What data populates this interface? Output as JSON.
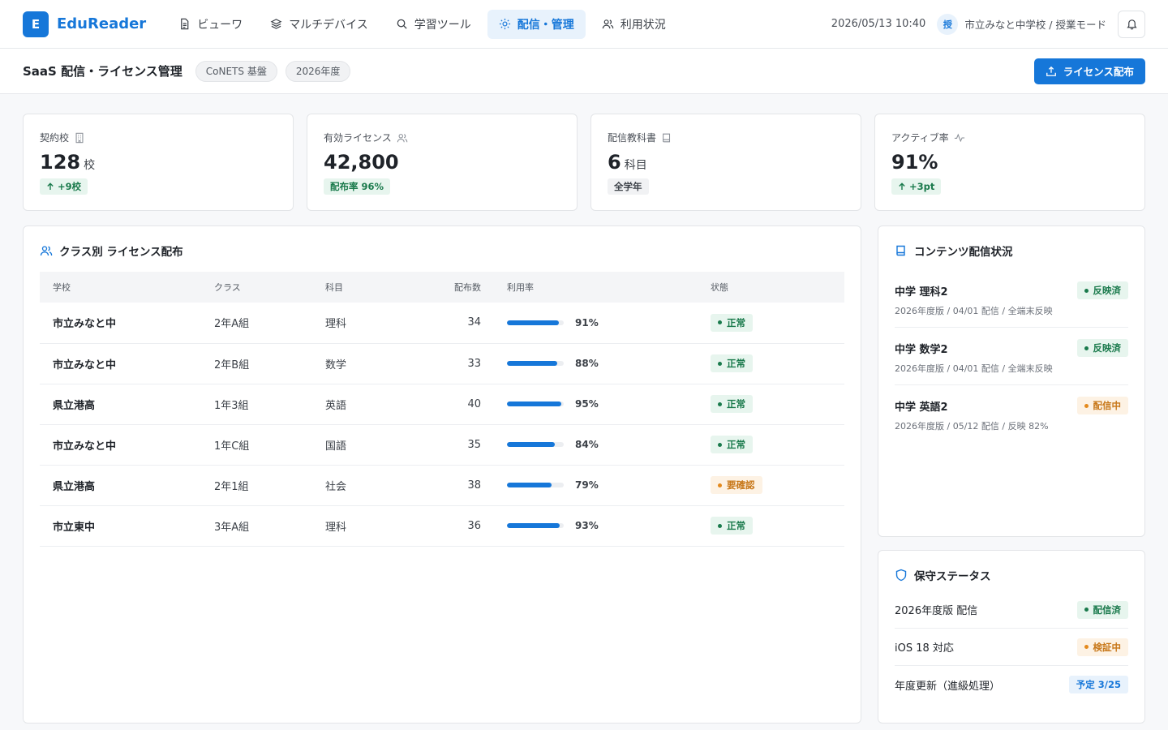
{
  "app": {
    "logo_letter": "E",
    "name": "EduReader"
  },
  "nav": [
    {
      "label": "ビューワ",
      "icon": "document-icon"
    },
    {
      "label": "マルチデバイス",
      "icon": "layers-icon"
    },
    {
      "label": "学習ツール",
      "icon": "search-icon"
    },
    {
      "label": "配信・管理",
      "icon": "sun-gear-icon",
      "active": true
    },
    {
      "label": "利用状況",
      "icon": "users-icon"
    }
  ],
  "header": {
    "datetime": "2026/05/13 10:40",
    "school_badge": "授",
    "school_mode": "市立みなと中学校 / 授業モード"
  },
  "page": {
    "title": "SaaS 配信・ライセンス管理",
    "chips": [
      "CoNETS 基盤",
      "2026年度"
    ],
    "primary_action": "ライセンス配布"
  },
  "stats": [
    {
      "label": "契約校",
      "icon": "building-icon",
      "value": "128",
      "unit": "校",
      "tag": "+9校",
      "tag_style": "green",
      "tag_arrow": true
    },
    {
      "label": "有効ライセンス",
      "icon": "users-icon",
      "value": "42,800",
      "unit": "",
      "tag": "配布率 96%",
      "tag_style": "green",
      "tag_arrow": false
    },
    {
      "label": "配信教科書",
      "icon": "book-icon",
      "value": "6",
      "unit": "科目",
      "tag": "全学年",
      "tag_style": "grey",
      "tag_arrow": false
    },
    {
      "label": "アクティブ率",
      "icon": "activity-icon",
      "value": "91%",
      "unit": "",
      "tag": "+3pt",
      "tag_style": "green",
      "tag_arrow": true
    }
  ],
  "license_table": {
    "title": "クラス別 ライセンス配布",
    "columns": [
      "学校",
      "クラス",
      "科目",
      "配布数",
      "利用率",
      "状態"
    ],
    "rows": [
      {
        "school": "市立みなと中",
        "class": "2年A組",
        "subject": "理科",
        "count": "34",
        "usage": 91,
        "usage_label": "91%",
        "status": "正常",
        "status_type": "ok"
      },
      {
        "school": "市立みなと中",
        "class": "2年B組",
        "subject": "数学",
        "count": "33",
        "usage": 88,
        "usage_label": "88%",
        "status": "正常",
        "status_type": "ok"
      },
      {
        "school": "県立港高",
        "class": "1年3組",
        "subject": "英語",
        "count": "40",
        "usage": 95,
        "usage_label": "95%",
        "status": "正常",
        "status_type": "ok"
      },
      {
        "school": "市立みなと中",
        "class": "1年C組",
        "subject": "国語",
        "count": "35",
        "usage": 84,
        "usage_label": "84%",
        "status": "正常",
        "status_type": "ok"
      },
      {
        "school": "県立港高",
        "class": "2年1組",
        "subject": "社会",
        "count": "38",
        "usage": 79,
        "usage_label": "79%",
        "status": "要確認",
        "status_type": "warn"
      },
      {
        "school": "市立東中",
        "class": "3年A組",
        "subject": "理科",
        "count": "36",
        "usage": 93,
        "usage_label": "93%",
        "status": "正常",
        "status_type": "ok"
      }
    ]
  },
  "content_status": {
    "title": "コンテンツ配信状況",
    "items": [
      {
        "name": "中学 理科2",
        "sub": "2026年度版 / 04/01 配信 / 全端末反映",
        "status": "反映済",
        "status_type": "ok"
      },
      {
        "name": "中学 数学2",
        "sub": "2026年度版 / 04/01 配信 / 全端末反映",
        "status": "反映済",
        "status_type": "ok"
      },
      {
        "name": "中学 英語2",
        "sub": "2026年度版 / 05/12 配信 / 反映 82%",
        "status": "配信中",
        "status_type": "warn"
      }
    ]
  },
  "maintenance": {
    "title": "保守ステータス",
    "items": [
      {
        "name": "2026年度版 配信",
        "status": "配信済",
        "status_type": "ok"
      },
      {
        "name": "iOS 18 対応",
        "status": "検証中",
        "status_type": "warn"
      },
      {
        "name": "年度更新（進級処理）",
        "status": "予定 3/25",
        "status_type": "plan"
      }
    ]
  },
  "colors": {
    "accent": "#1677d9",
    "ok": "#1a7a4c",
    "warn": "#e48a1d"
  }
}
